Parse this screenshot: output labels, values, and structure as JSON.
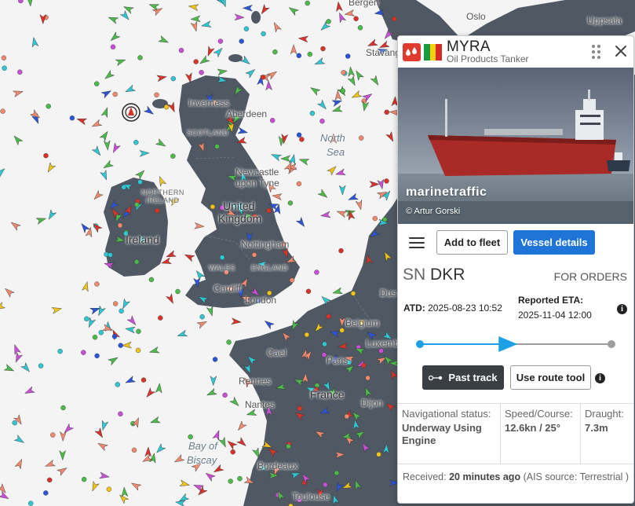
{
  "map": {
    "labels": {
      "inverness": "Inverness",
      "aberdeen": "Aberdeen",
      "scotland": "SCOTLAND",
      "north_sea_1": "North",
      "north_sea_2": "Sea",
      "newcastle_1": "Newcastle",
      "newcastle_2": "upon Tyne",
      "northern_ireland_1": "NORTHERN",
      "northern_ireland_2": "IRELAND",
      "united_kingdom_1": "United",
      "united_kingdom_2": "Kingdom",
      "ireland": "Ireland",
      "nottingham": "Nottingham",
      "wales": "WALES",
      "england": "ENGLAND",
      "cardiff": "Cardiff",
      "london": "London",
      "belgium": "Belgium",
      "luxemb": "Luxemb",
      "paris": "Paris",
      "france": "France",
      "rennes": "Rennes",
      "nantes": "Nantes",
      "dijon": "Dijon",
      "bay_1": "Bay of",
      "bay_2": "Biscay",
      "bordeaux": "Bordeaux",
      "toulouse": "Toulouse",
      "oslo": "Oslo",
      "uppsala": "Uppsala",
      "bergen": "Bergen",
      "stavanger": "Stavanger",
      "cael": "Cael",
      "dus": "Dus"
    }
  },
  "vessel": {
    "name": "MYRA",
    "type": "Oil Products Tanker",
    "flag_colors": [
      "#1a9a3e",
      "#f5d20b",
      "#d92a2a"
    ],
    "type_badge_color": "#e03b2f",
    "photo": {
      "brand": "marinetraffic",
      "credit": "© Artur Gorski"
    },
    "actions": {
      "add_to_fleet": "Add to fleet",
      "vessel_details": "Vessel details",
      "past_track": "Past track",
      "use_route_tool": "Use route tool"
    },
    "route": {
      "origin_prefix": "SN",
      "origin_code": "DKR",
      "destination": "FOR ORDERS"
    },
    "atd": {
      "label": "ATD:",
      "value": "2025-08-23 10:52"
    },
    "eta": {
      "label": "Reported ETA:",
      "value": "2025-11-04 12:00"
    },
    "voyage_progress": 0.46,
    "stats": {
      "nav_label": "Navigational status:",
      "nav_value": "Underway Using Engine",
      "speed_label": "Speed/Course:",
      "speed_value": "12.6kn / 25°",
      "draught_label": "Draught:",
      "draught_value": "7.3m"
    },
    "received": {
      "label": "Received:",
      "value": "20 minutes ago",
      "source": "(AIS source: Terrestrial )"
    }
  }
}
